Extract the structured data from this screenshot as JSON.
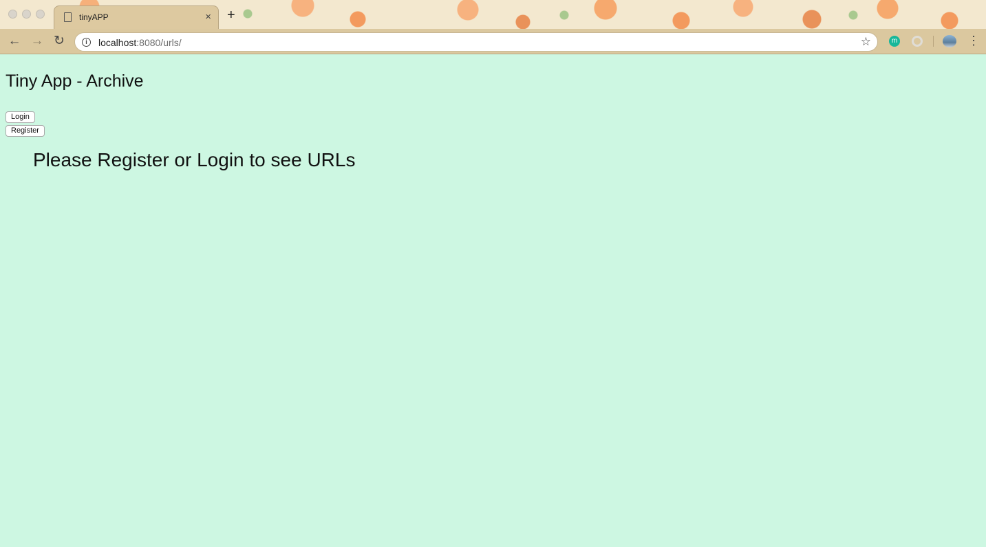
{
  "browser": {
    "tab_title": "tinyAPP",
    "tab_close": "×",
    "new_tab": "+",
    "url_host": "localhost",
    "url_rest": ":8080/urls/",
    "nav": {
      "back": "←",
      "forward": "→",
      "reload": "↻"
    },
    "star": "☆",
    "menu": "⋮",
    "extension_m": "m"
  },
  "page": {
    "title": "Tiny App - Archive",
    "login_label": "Login",
    "register_label": "Register",
    "message": "Please Register or Login to see URLs"
  }
}
